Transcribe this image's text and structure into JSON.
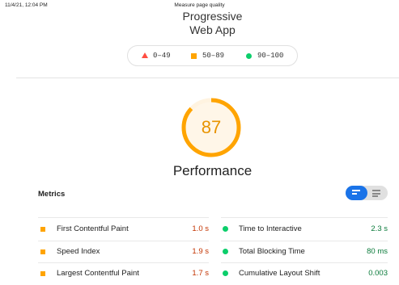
{
  "print_header": {
    "date": "11/4/21, 12:04 PM",
    "title": "Measure page quality"
  },
  "category": {
    "line1": "Progressive",
    "line2": "Web App"
  },
  "legend": [
    {
      "shape": "triangle",
      "label": "0–49",
      "color": "#ff4e42"
    },
    {
      "shape": "square",
      "label": "50–89",
      "color": "#ffa400"
    },
    {
      "shape": "circle",
      "label": "90–100",
      "color": "#0cce6b"
    }
  ],
  "gauge": {
    "score": "87",
    "fill_fraction": 0.87,
    "color": "#ffa400",
    "track_color": "#fff3e0"
  },
  "performance_title": "Performance",
  "metrics": {
    "title": "Metrics",
    "left": [
      {
        "label": "First Contentful Paint",
        "value": "1.0 s",
        "status": "average"
      },
      {
        "label": "Speed Index",
        "value": "1.9 s",
        "status": "average"
      },
      {
        "label": "Largest Contentful Paint",
        "value": "1.7 s",
        "status": "average"
      }
    ],
    "right": [
      {
        "label": "Time to Interactive",
        "value": "2.3 s",
        "status": "pass"
      },
      {
        "label": "Total Blocking Time",
        "value": "80 ms",
        "status": "pass"
      },
      {
        "label": "Cumulative Layout Shift",
        "value": "0.003",
        "status": "pass"
      }
    ]
  },
  "toggle": {
    "active": "view-icon-compact",
    "accent": "#1a73e8"
  }
}
